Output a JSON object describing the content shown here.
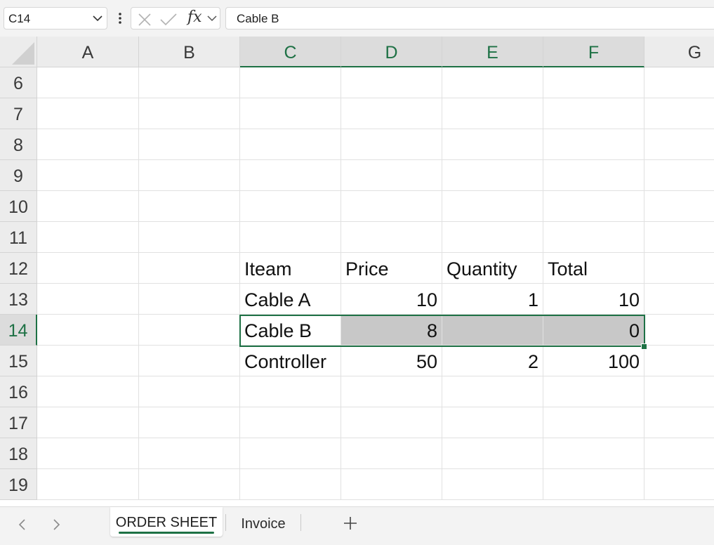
{
  "formula_bar": {
    "name_box": "C14",
    "formula": "Cable B",
    "fx_label": "fx",
    "icons": [
      "chevron-down-icon",
      "more-vertical-icon",
      "cancel-x-icon",
      "enter-check-icon",
      "function-icon",
      "chevron-down-icon"
    ]
  },
  "columns": [
    "A",
    "B",
    "C",
    "D",
    "E",
    "F",
    "G"
  ],
  "selected_column_headers": [
    "C",
    "D",
    "E",
    "F"
  ],
  "rows": [
    "6",
    "7",
    "8",
    "9",
    "10",
    "11",
    "12",
    "13",
    "14",
    "15",
    "16",
    "17",
    "18",
    "19"
  ],
  "selected_row": "14",
  "active_cell": "C14",
  "selected_range": "C14:F14",
  "table": {
    "header": [
      "Iteam",
      "Price",
      "Quantity",
      "Total"
    ],
    "body": [
      [
        "Cable A",
        "10",
        "1",
        "10"
      ],
      [
        "Cable B",
        "8",
        "",
        "0"
      ],
      [
        "Controller",
        "50",
        "2",
        "100"
      ]
    ]
  },
  "sheets": {
    "tabs": [
      "ORDER SHEET",
      "Invoice"
    ],
    "active": "ORDER SHEET",
    "nav_icons": [
      "chevron-left-icon",
      "chevron-right-icon",
      "plus-icon"
    ]
  },
  "colors": {
    "accent_green": "#1e7145",
    "selection_fill": "#c8c8c8",
    "header_bg": "#ececec",
    "selected_header_bg": "#dcdcdc",
    "gridline": "#e1e1e1"
  }
}
